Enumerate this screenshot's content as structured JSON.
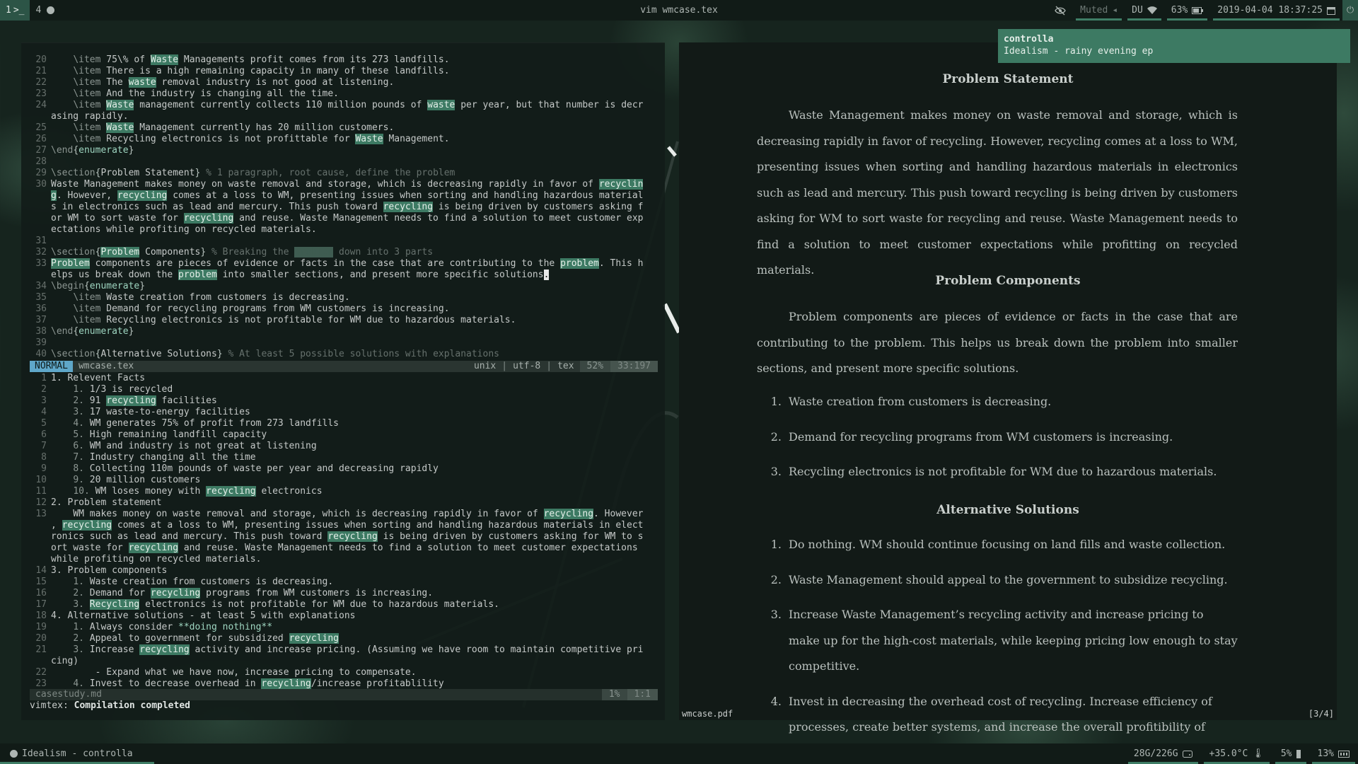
{
  "topbar": {
    "workspaces": [
      "1",
      "4"
    ],
    "window_title": "vim wmcase.tex",
    "volume": "Muted",
    "keyboard": "DU",
    "battery": "63%",
    "datetime": "2019-04-04 18:37:25"
  },
  "notification": {
    "app": "controlla",
    "text": "Idealism - rainy evening ep"
  },
  "vim": {
    "top_lines": [
      {
        "n": "20",
        "segs": [
          [
            "    ",
            "t"
          ],
          [
            "\\item",
            "c"
          ],
          [
            " 75\\% of ",
            "t"
          ],
          [
            "Waste",
            "h"
          ],
          [
            " Managements profit comes from its 273 landfills.",
            "t"
          ]
        ]
      },
      {
        "n": "21",
        "segs": [
          [
            "    ",
            "t"
          ],
          [
            "\\item",
            "c"
          ],
          [
            " There is a high remaining capacity in many of these landfills.",
            "t"
          ]
        ]
      },
      {
        "n": "22",
        "segs": [
          [
            "    ",
            "t"
          ],
          [
            "\\item",
            "c"
          ],
          [
            " The ",
            "t"
          ],
          [
            "waste",
            "h"
          ],
          [
            " removal industry is not good at listening.",
            "t"
          ]
        ]
      },
      {
        "n": "23",
        "segs": [
          [
            "    ",
            "t"
          ],
          [
            "\\item",
            "c"
          ],
          [
            " And the industry is changing all the time.",
            "t"
          ]
        ]
      },
      {
        "n": "24",
        "segs": [
          [
            "    ",
            "t"
          ],
          [
            "\\item",
            "c"
          ],
          [
            " ",
            "t"
          ],
          [
            "Waste",
            "h"
          ],
          [
            " management currently collects 110 million pounds of ",
            "t"
          ],
          [
            "waste",
            "h"
          ],
          [
            " per year, but that number is decr",
            "t"
          ]
        ]
      },
      {
        "n": "",
        "segs": [
          [
            "asing rapidly.",
            "t"
          ]
        ]
      },
      {
        "n": "25",
        "segs": [
          [
            "    ",
            "t"
          ],
          [
            "\\item",
            "c"
          ],
          [
            " ",
            "t"
          ],
          [
            "Waste",
            "h"
          ],
          [
            " Management currently has 20 million customers.",
            "t"
          ]
        ]
      },
      {
        "n": "26",
        "segs": [
          [
            "    ",
            "t"
          ],
          [
            "\\item",
            "c"
          ],
          [
            " Recycling electronics is not profittable for ",
            "t"
          ],
          [
            "Waste",
            "h"
          ],
          [
            " Management.",
            "t"
          ]
        ]
      },
      {
        "n": "27",
        "segs": [
          [
            "\\end",
            "c"
          ],
          [
            "{",
            "b"
          ],
          [
            "enumerate",
            "k"
          ],
          [
            "}",
            "b"
          ]
        ]
      },
      {
        "n": "28",
        "segs": []
      },
      {
        "n": "29",
        "segs": [
          [
            "\\section",
            "c"
          ],
          [
            "{",
            "b"
          ],
          [
            "Problem Statement",
            "t"
          ],
          [
            "}",
            "b"
          ],
          [
            " % 1 paragraph, root cause, define the problem",
            "m"
          ]
        ]
      },
      {
        "n": "30",
        "segs": [
          [
            "Waste Management makes money on waste removal and storage, which is decreasing rapidly in favor of ",
            "t"
          ],
          [
            "recyclin",
            "h"
          ]
        ]
      },
      {
        "n": "",
        "segs": [
          [
            "g",
            "h"
          ],
          [
            ". However, ",
            "t"
          ],
          [
            "recycling",
            "h"
          ],
          [
            " comes at a loss to WM, presenting issues when sorting and handling hazardous material",
            "t"
          ]
        ]
      },
      {
        "n": "",
        "segs": [
          [
            "s in electronics such as lead and mercury. This push toward ",
            "t"
          ],
          [
            "recycling",
            "h"
          ],
          [
            " is being driven by customers asking f",
            "t"
          ]
        ]
      },
      {
        "n": "",
        "segs": [
          [
            "or WM to sort waste for ",
            "t"
          ],
          [
            "recycling",
            "h"
          ],
          [
            " and reuse. Waste Management needs to find a solution to meet customer exp",
            "t"
          ]
        ]
      },
      {
        "n": "",
        "segs": [
          [
            "ectations while profiting on recycled materials.",
            "t"
          ]
        ]
      },
      {
        "n": "31",
        "segs": []
      },
      {
        "n": "32",
        "segs": [
          [
            "\\section",
            "c"
          ],
          [
            "{",
            "b"
          ],
          [
            "Problem",
            "h"
          ],
          [
            " Components",
            "t"
          ],
          [
            "}",
            "b"
          ],
          [
            " % Breaking the ",
            "m"
          ],
          [
            "problem",
            "d"
          ],
          [
            " down into 3 parts",
            "m"
          ]
        ]
      },
      {
        "n": "33",
        "segs": [
          [
            "Problem",
            "h"
          ],
          [
            " components are pieces of evidence or facts in the case that are contributing to the ",
            "t"
          ],
          [
            "problem",
            "h"
          ],
          [
            ". This h",
            "t"
          ]
        ]
      },
      {
        "n": "",
        "segs": [
          [
            "elps us break down the ",
            "t"
          ],
          [
            "problem",
            "h"
          ],
          [
            " into smaller sections, and present more specific solutions",
            "t"
          ],
          [
            ".",
            "u"
          ]
        ]
      },
      {
        "n": "34",
        "segs": [
          [
            "\\begin",
            "c"
          ],
          [
            "{",
            "b"
          ],
          [
            "enumerate",
            "k"
          ],
          [
            "}",
            "b"
          ]
        ]
      },
      {
        "n": "35",
        "segs": [
          [
            "    ",
            "t"
          ],
          [
            "\\item",
            "c"
          ],
          [
            " Waste creation from customers is decreasing.",
            "t"
          ]
        ]
      },
      {
        "n": "36",
        "segs": [
          [
            "    ",
            "t"
          ],
          [
            "\\item",
            "c"
          ],
          [
            " Demand for recycling programs from WM customers is increasing.",
            "t"
          ]
        ]
      },
      {
        "n": "37",
        "segs": [
          [
            "    ",
            "t"
          ],
          [
            "\\item",
            "c"
          ],
          [
            " Recycling electronics is not profitable for WM due to hazardous materials.",
            "t"
          ]
        ]
      },
      {
        "n": "38",
        "segs": [
          [
            "\\end",
            "c"
          ],
          [
            "{",
            "b"
          ],
          [
            "enumerate",
            "k"
          ],
          [
            "}",
            "b"
          ]
        ]
      },
      {
        "n": "39",
        "segs": []
      },
      {
        "n": "40",
        "segs": [
          [
            "\\section",
            "c"
          ],
          [
            "{",
            "b"
          ],
          [
            "Alternative Solutions",
            "t"
          ],
          [
            "}",
            "b"
          ],
          [
            " % At least 5 possible solutions with explanations",
            "m"
          ]
        ]
      }
    ],
    "status_top": {
      "mode": "NORMAL",
      "file": "wmcase.tex",
      "format": "unix",
      "encoding": "utf-8",
      "filetype": "tex",
      "percent": "52%",
      "position": "33:197"
    },
    "bottom_lines": [
      {
        "n": "1",
        "segs": [
          [
            "1. Relevent Facts",
            "t"
          ]
        ]
      },
      {
        "n": "2",
        "segs": [
          [
            "    ",
            "t"
          ],
          [
            "1.",
            "c"
          ],
          [
            " 1/3 is recycled",
            "t"
          ]
        ]
      },
      {
        "n": "3",
        "segs": [
          [
            "    ",
            "t"
          ],
          [
            "2.",
            "c"
          ],
          [
            " 91 ",
            "t"
          ],
          [
            "recycling",
            "h"
          ],
          [
            " facilities",
            "t"
          ]
        ]
      },
      {
        "n": "4",
        "segs": [
          [
            "    ",
            "t"
          ],
          [
            "3.",
            "c"
          ],
          [
            " 17 waste-to-energy facilities",
            "t"
          ]
        ]
      },
      {
        "n": "5",
        "segs": [
          [
            "    ",
            "t"
          ],
          [
            "4.",
            "c"
          ],
          [
            " WM generates 75% of profit from 273 landfills",
            "t"
          ]
        ]
      },
      {
        "n": "6",
        "segs": [
          [
            "    ",
            "t"
          ],
          [
            "5.",
            "c"
          ],
          [
            " High remaining landfill capacity",
            "t"
          ]
        ]
      },
      {
        "n": "7",
        "segs": [
          [
            "    ",
            "t"
          ],
          [
            "6.",
            "c"
          ],
          [
            " WM and industry is not great at listening",
            "t"
          ]
        ]
      },
      {
        "n": "8",
        "segs": [
          [
            "    ",
            "t"
          ],
          [
            "7.",
            "c"
          ],
          [
            " Industry changing all the time",
            "t"
          ]
        ]
      },
      {
        "n": "9",
        "segs": [
          [
            "    ",
            "t"
          ],
          [
            "8.",
            "c"
          ],
          [
            " Collecting 110m pounds of waste per year and decreasing rapidly",
            "t"
          ]
        ]
      },
      {
        "n": "10",
        "segs": [
          [
            "    ",
            "t"
          ],
          [
            "9.",
            "c"
          ],
          [
            " 20 million customers",
            "t"
          ]
        ]
      },
      {
        "n": "11",
        "segs": [
          [
            "    ",
            "t"
          ],
          [
            "10.",
            "c"
          ],
          [
            " WM loses money with ",
            "t"
          ],
          [
            "recycling",
            "h"
          ],
          [
            " electronics",
            "t"
          ]
        ]
      },
      {
        "n": "12",
        "segs": [
          [
            "2. Problem statement",
            "t"
          ]
        ]
      },
      {
        "n": "13",
        "segs": [
          [
            "    WM makes money on waste removal and storage, which is decreasing rapidly in favor of ",
            "t"
          ],
          [
            "recycling",
            "h"
          ],
          [
            ". However",
            "t"
          ]
        ]
      },
      {
        "n": "",
        "segs": [
          [
            ", ",
            "t"
          ],
          [
            "recycling",
            "h"
          ],
          [
            " comes at a loss to WM, presenting issues when sorting and handling hazardous materials in elect",
            "t"
          ]
        ]
      },
      {
        "n": "",
        "segs": [
          [
            "ronics such as lead and mercury. This push toward ",
            "t"
          ],
          [
            "recycling",
            "h"
          ],
          [
            " is being driven by customers asking for WM to s",
            "t"
          ]
        ]
      },
      {
        "n": "",
        "segs": [
          [
            "ort waste for ",
            "t"
          ],
          [
            "recycling",
            "h"
          ],
          [
            " and reuse. Waste Management needs to find a solution to meet customer expectations",
            "t"
          ]
        ]
      },
      {
        "n": "",
        "segs": [
          [
            "while profiting on recycled materials.",
            "t"
          ]
        ]
      },
      {
        "n": "14",
        "segs": [
          [
            "3. Problem components",
            "t"
          ]
        ]
      },
      {
        "n": "15",
        "segs": [
          [
            "    ",
            "t"
          ],
          [
            "1.",
            "c"
          ],
          [
            " Waste creation from customers is decreasing.",
            "t"
          ]
        ]
      },
      {
        "n": "16",
        "segs": [
          [
            "    ",
            "t"
          ],
          [
            "2.",
            "c"
          ],
          [
            " Demand for ",
            "t"
          ],
          [
            "recycling",
            "h"
          ],
          [
            " programs from WM customers is increasing.",
            "t"
          ]
        ]
      },
      {
        "n": "17",
        "segs": [
          [
            "    ",
            "t"
          ],
          [
            "3.",
            "c"
          ],
          [
            " ",
            "t"
          ],
          [
            "Recycling",
            "h"
          ],
          [
            " electronics is not profitable for WM due to hazardous materials.",
            "t"
          ]
        ]
      },
      {
        "n": "18",
        "segs": [
          [
            "4. Alternative solutions - at least 5 with explanations",
            "t"
          ]
        ]
      },
      {
        "n": "19",
        "segs": [
          [
            "    ",
            "t"
          ],
          [
            "1.",
            "c"
          ],
          [
            " Always consider ",
            "t"
          ],
          [
            "**doing nothing**",
            "k"
          ]
        ]
      },
      {
        "n": "20",
        "segs": [
          [
            "    ",
            "t"
          ],
          [
            "2.",
            "c"
          ],
          [
            " Appeal to government for subsidized ",
            "t"
          ],
          [
            "recycling",
            "h"
          ]
        ]
      },
      {
        "n": "21",
        "segs": [
          [
            "    ",
            "t"
          ],
          [
            "3.",
            "c"
          ],
          [
            " Increase ",
            "t"
          ],
          [
            "recycling",
            "h"
          ],
          [
            " activity and increase pricing. (Assuming we have room to maintain competitive pri",
            "t"
          ]
        ]
      },
      {
        "n": "",
        "segs": [
          [
            "cing)",
            "t"
          ]
        ]
      },
      {
        "n": "22",
        "segs": [
          [
            "        - Expand what we have now, increase pricing to compensate.",
            "t"
          ]
        ]
      },
      {
        "n": "23",
        "segs": [
          [
            "    ",
            "t"
          ],
          [
            "4.",
            "c"
          ],
          [
            " Invest to decrease overhead in ",
            "t"
          ],
          [
            "recycling",
            "h"
          ],
          [
            "/increase profitablility",
            "t"
          ]
        ]
      }
    ],
    "status_bottom": {
      "file": "casestudy.md",
      "percent": "1%",
      "position": "1:1"
    },
    "message_prefix": "vimtex: ",
    "message": "Compilation completed"
  },
  "pdf": {
    "sections": [
      {
        "heading": "Problem Statement",
        "paragraph": "Waste Management makes money on waste removal and storage, which is decreasing rapidly in favor of recycling. However, recycling comes at a loss to WM, presenting issues when sorting and handling hazardous materials in electronics such as lead and mercury. This push toward recycling is being driven by customers asking for WM to sort waste for recycling and reuse. Waste Management needs to find a solution to meet customer expectations while profitting on recycled materials."
      },
      {
        "heading": "Problem Components",
        "paragraph": "Problem components are pieces of evidence or facts in the case that are contributing to the problem. This helps us break down the problem into smaller sections, and present more specific solutions.",
        "items": [
          "Waste creation from customers is decreasing.",
          "Demand for recycling programs from WM customers is increasing.",
          "Recycling electronics is not profitable for WM due to hazardous materials."
        ]
      },
      {
        "heading": "Alternative Solutions",
        "items": [
          "Do nothing. WM should continue focusing on land fills and waste collection.",
          "Waste Management should appeal to the government to subsidize recycling.",
          "Increase Waste Management’s recycling activity and increase pricing to make up for the high-cost materials, while keeping pricing low enough to stay competitive.",
          "Invest in decreasing the overhead cost of recycling. Increase efficiency of processes, create better systems, and increase the overall profitibility of recycling."
        ]
      }
    ],
    "status_file": "wmcase.pdf",
    "page": "[3/4]"
  },
  "bottombar": {
    "media": "Idealism - controlla",
    "disk": "28G/226G",
    "temperature": "+35.0°C",
    "cpu": "5%",
    "memory": "13%"
  },
  "colors": {
    "accent": "#3d7a63",
    "mode_normal": "#5fa7c9",
    "bar_bg": "#111b17"
  }
}
